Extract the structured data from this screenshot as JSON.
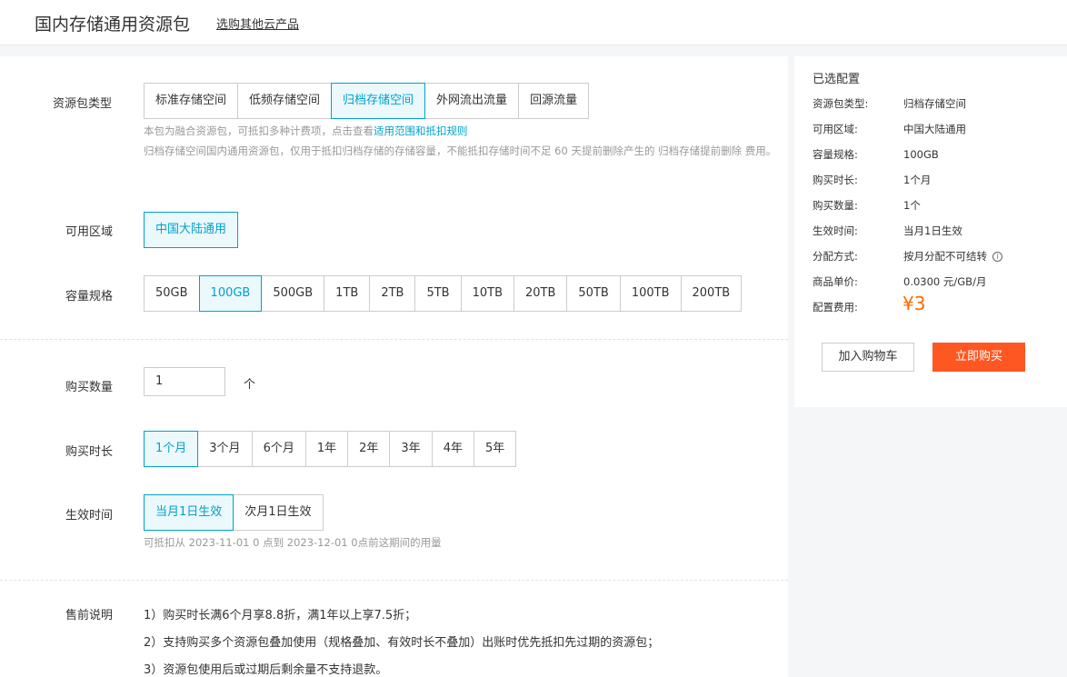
{
  "header": {
    "title": "国内存储通用资源包",
    "other_link": "选购其他云产品"
  },
  "package_type": {
    "label": "资源包类型",
    "options": [
      "标准存储空间",
      "低频存储空间",
      "归档存储空间",
      "外网流出流量",
      "回源流量"
    ],
    "selected": 2,
    "hint1_prefix": "本包为融合资源包，可抵扣多种计费项，点击查看",
    "hint1_link": "适用范围和抵扣规则",
    "hint2": "归档存储空间国内通用资源包，仅用于抵扣归档存储的存储容量，不能抵扣存储时间不足 60 天提前删除产生的 归档存储提前删除 费用。"
  },
  "region": {
    "label": "可用区域",
    "options": [
      "中国大陆通用"
    ],
    "selected": 0
  },
  "capacity": {
    "label": "容量规格",
    "options": [
      "50GB",
      "100GB",
      "500GB",
      "1TB",
      "2TB",
      "5TB",
      "10TB",
      "20TB",
      "50TB",
      "100TB",
      "200TB"
    ],
    "selected": 1
  },
  "quantity": {
    "label": "购买数量",
    "value": "1",
    "unit": "个"
  },
  "duration": {
    "label": "购买时长",
    "options": [
      "1个月",
      "3个月",
      "6个月",
      "1年",
      "2年",
      "3年",
      "4年",
      "5年"
    ],
    "selected": 0
  },
  "effective": {
    "label": "生效时间",
    "options": [
      "当月1日生效",
      "次月1日生效"
    ],
    "selected": 0,
    "hint": "可抵扣从 2023-11-01 0 点到 2023-12-01 0点前这期间的用量"
  },
  "presale": {
    "label": "售前说明",
    "notes": [
      "1）购买时长满6个月享8.8折，满1年以上享7.5折；",
      "2）支持购买多个资源包叠加使用（规格叠加、有效时长不叠加）出账时优先抵扣先过期的资源包；",
      "3）资源包使用后或过期后剩余量不支持退款。"
    ]
  },
  "summary": {
    "title": "已选配置",
    "rows": [
      {
        "k": "资源包类型:",
        "v": "归档存储空间"
      },
      {
        "k": "可用区域:",
        "v": "中国大陆通用"
      },
      {
        "k": "容量规格:",
        "v": "100GB"
      },
      {
        "k": "购买时长:",
        "v": "1个月"
      },
      {
        "k": "购买数量:",
        "v": "1个"
      },
      {
        "k": "生效时间:",
        "v": "当月1日生效"
      },
      {
        "k": "分配方式:",
        "v": "按月分配不可结转"
      },
      {
        "k": "商品单价:",
        "v": "0.0300 元/GB/月"
      },
      {
        "k": "配置费用:",
        "v": ""
      }
    ],
    "price": "¥3",
    "cart_label": "加入购物车",
    "buy_label": "立即购买"
  },
  "colors": {
    "accent": "#00a2ca",
    "price": "#ff6a00",
    "buy": "#ff5722"
  }
}
